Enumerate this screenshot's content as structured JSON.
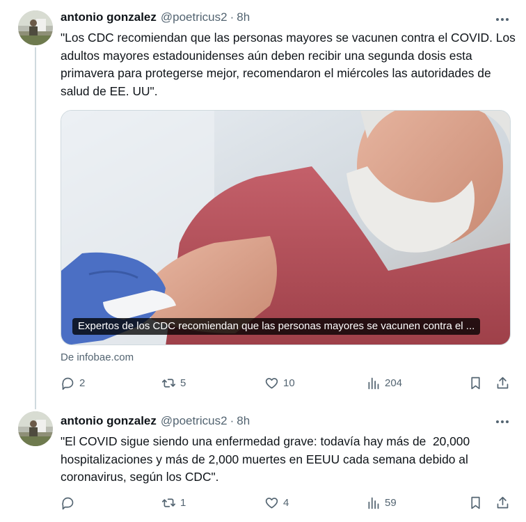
{
  "tweets": [
    {
      "author_name": "antonio gonzalez",
      "handle": "@poetricus2",
      "separator": "·",
      "time": "8h",
      "text": "\"Los CDC recomiendan que las personas mayores se vacunen contra el COVID. Los adultos mayores estadounidenses aún deben recibir una segunda dosis esta primavera para protegerse mejor, recomendaron el miércoles las autoridades de salud de EE. UU\".",
      "card": {
        "caption": "Expertos de los CDC recomiendan que las personas mayores se vacunen contra el ...",
        "source": "De infobae.com"
      },
      "stats": {
        "replies": "2",
        "reposts": "5",
        "likes": "10",
        "views": "204"
      }
    },
    {
      "author_name": "antonio gonzalez",
      "handle": "@poetricus2",
      "separator": "·",
      "time": "8h",
      "text": "\"El COVID sigue siendo una enfermedad grave: todavía hay más de  20,000 hospitalizaciones y más de 2,000 muertes en EEUU cada semana debido al coronavirus, según los CDC\".",
      "stats": {
        "replies": "",
        "reposts": "1",
        "likes": "4",
        "views": "59"
      }
    }
  ],
  "colors": {
    "text": "#0f1419",
    "secondary": "#536471",
    "border": "#cfd9de",
    "shirt": "#b5505a",
    "glove": "#4b6fc4"
  }
}
